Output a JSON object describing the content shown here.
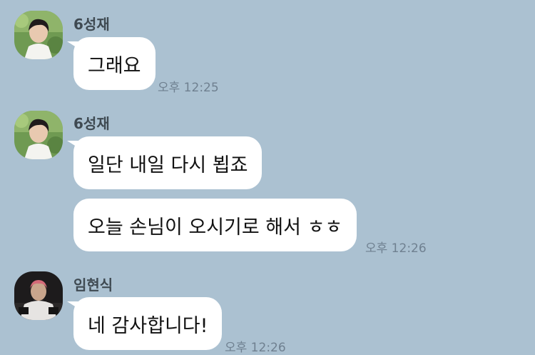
{
  "messages": [
    {
      "sender": "6성재",
      "avatar": "portrait-avatar-icon",
      "bubbles": [
        "그래요"
      ],
      "time": "오후 12:25"
    },
    {
      "sender": "6성재",
      "avatar": "portrait-avatar-icon",
      "bubbles": [
        "일단 내일 다시 뵙죠",
        "오늘 손님이 오시기로 해서 ㅎㅎ"
      ],
      "time": "오후 12:26"
    },
    {
      "sender": "임현식",
      "avatar": "dark-portrait-avatar-icon",
      "bubbles": [
        "네 감사합니다!"
      ],
      "time": "오후 12:26"
    }
  ],
  "colors": {
    "background": "#abc1d1",
    "bubble": "#ffffff",
    "sender_text": "#3f4a52",
    "time_text": "#6f8090"
  }
}
